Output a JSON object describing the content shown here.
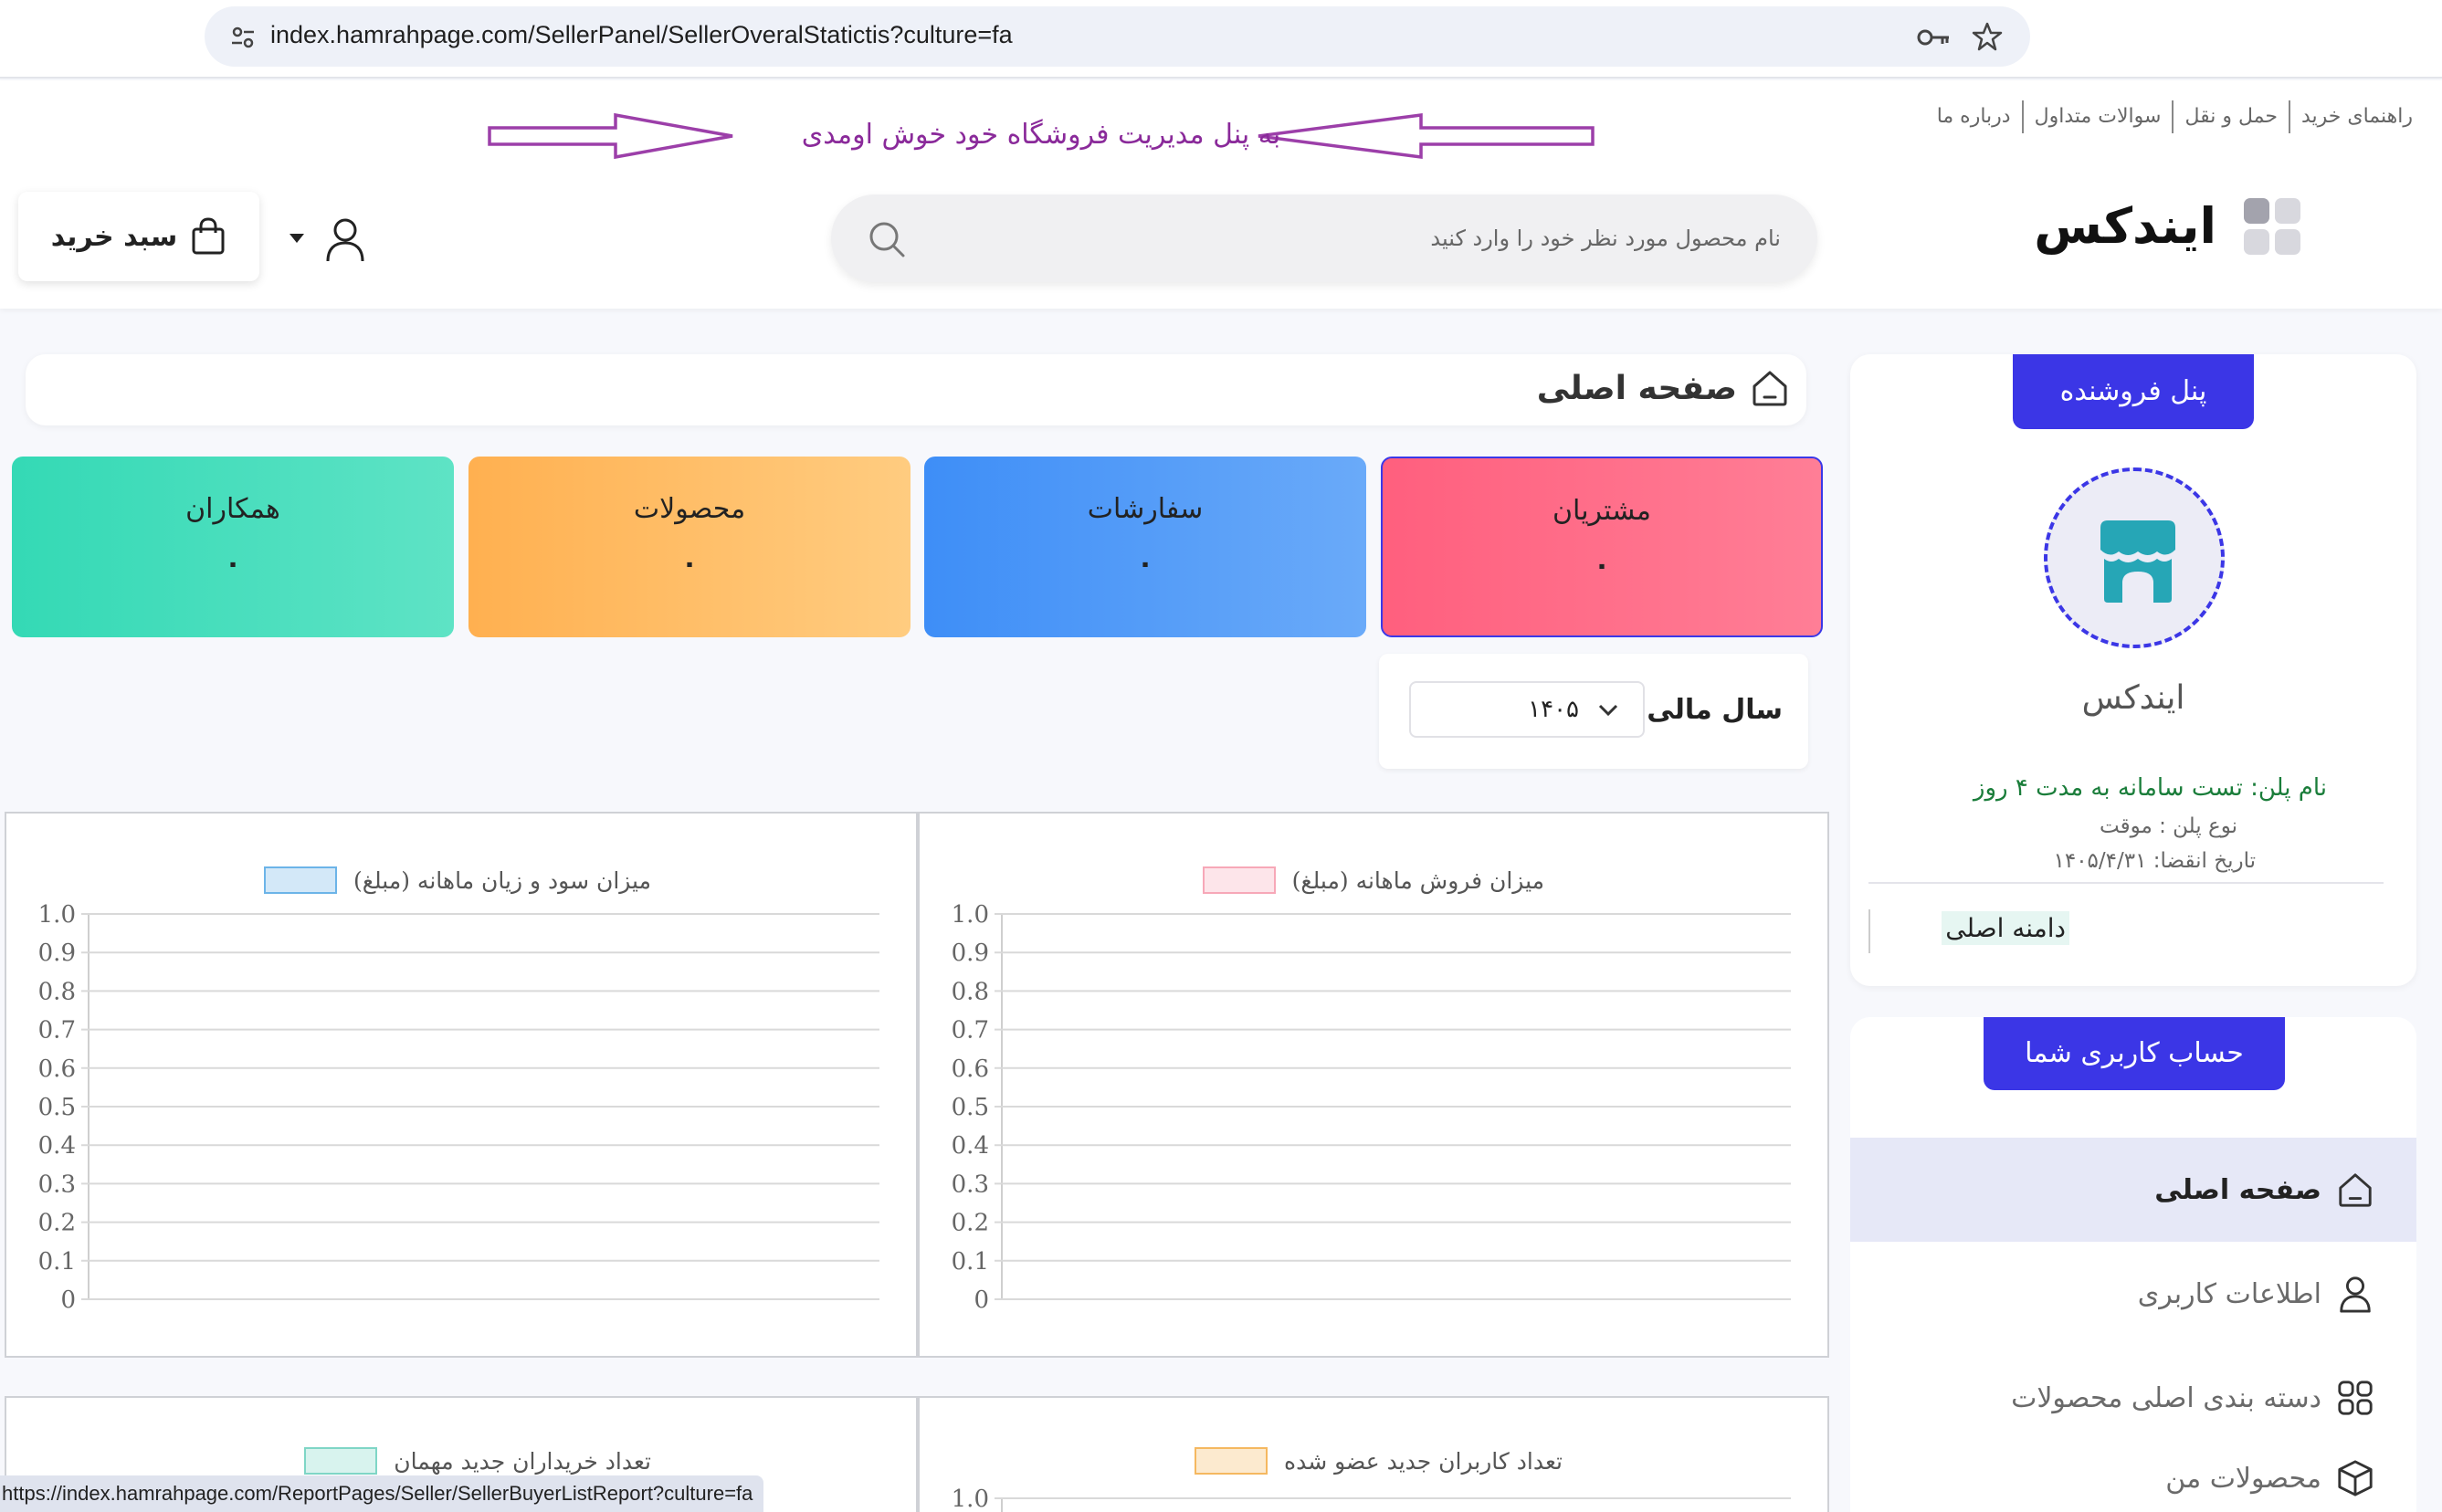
{
  "browser": {
    "url": "index.hamrahpage.com/SellerPanel/SellerOveralStatictis?culture=fa"
  },
  "header": {
    "top_links": [
      "راهنمای خرید",
      "حمل و نقل",
      "سوالات متداول",
      "درباره ما"
    ],
    "welcome": "به پنل مدیریت فروشگاه خود خوش اومدی",
    "logo": "ایندکس",
    "search_placeholder": "نام محصول مورد نظر خود را وارد کنید",
    "cart_label": "سبد خرید",
    "accent_color": "#8a2a9a"
  },
  "breadcrumb": {
    "title": "صفحه اصلی"
  },
  "stats": [
    {
      "title": "مشتریان",
      "value": "۰"
    },
    {
      "title": "سفارشات",
      "value": "۰"
    },
    {
      "title": "محصولات",
      "value": "۰"
    },
    {
      "title": "همکاران",
      "value": "۰"
    }
  ],
  "fiscal": {
    "label": "سال مالی:",
    "selected": "۱۴۰۵"
  },
  "chart_data": [
    {
      "type": "line",
      "title": "میزان فروش ماهانه (مبلغ)",
      "series": [
        {
          "name": "میزان فروش ماهانه (مبلغ)",
          "values": []
        }
      ],
      "yticks": [
        "0",
        "0.1",
        "0.2",
        "0.3",
        "0.4",
        "0.5",
        "0.6",
        "0.7",
        "0.8",
        "0.9",
        "1.0"
      ],
      "ylim": [
        0,
        1
      ],
      "grid": true,
      "legend": "top-center",
      "color": "#f7a8b8"
    },
    {
      "type": "line",
      "title": "میزان سود و زیان ماهانه (مبلغ)",
      "series": [
        {
          "name": "میزان سود و زیان ماهانه (مبلغ)",
          "values": []
        }
      ],
      "yticks": [
        "0",
        "0.1",
        "0.2",
        "0.3",
        "0.4",
        "0.5",
        "0.6",
        "0.7",
        "0.8",
        "0.9",
        "1.0"
      ],
      "ylim": [
        0,
        1
      ],
      "grid": true,
      "legend": "top-center",
      "color": "#6cb4e8"
    },
    {
      "type": "line",
      "title": "تعداد  کاربران جدید عضو شده",
      "series": [
        {
          "name": "تعداد  کاربران جدید عضو شده",
          "values": []
        }
      ],
      "yticks": [
        "1.0"
      ],
      "ylim": [
        0,
        1
      ],
      "grid": true,
      "legend": "top-center",
      "color": "#f5b860"
    },
    {
      "type": "line",
      "title": "تعداد خریداران  جدید مهمان",
      "series": [
        {
          "name": "تعداد خریداران  جدید مهمان",
          "values": []
        }
      ],
      "ylim": [
        0,
        1
      ],
      "grid": true,
      "legend": "top-center",
      "color": "#7fd6c6"
    }
  ],
  "sidebar": {
    "seller_panel_label": "پنل فروشنده",
    "store_name": "ایندکس",
    "plan_name": "نام پلن: تست سامانه به مدت ۴ روز",
    "plan_type": "نوع پلن : موقت",
    "plan_expire": "تاریخ انقضا: ۱۴۰۵/۴/۳۱",
    "domain_label": "دامنه اصلی",
    "account_label": "حساب کاربری شما",
    "menu": [
      {
        "label": "صفحه اصلی",
        "icon": "home-icon"
      },
      {
        "label": "اطلاعات کاربری",
        "icon": "user-icon"
      },
      {
        "label": "دسته بندی اصلی محصولات",
        "icon": "grid-icon"
      },
      {
        "label": "محصولات من",
        "icon": "box-icon"
      }
    ],
    "accent_color": "#3b36e6"
  },
  "status_bar": {
    "url": "https://index.hamrahpage.com/ReportPages/Seller/SellerBuyerListReport?culture=fa"
  }
}
